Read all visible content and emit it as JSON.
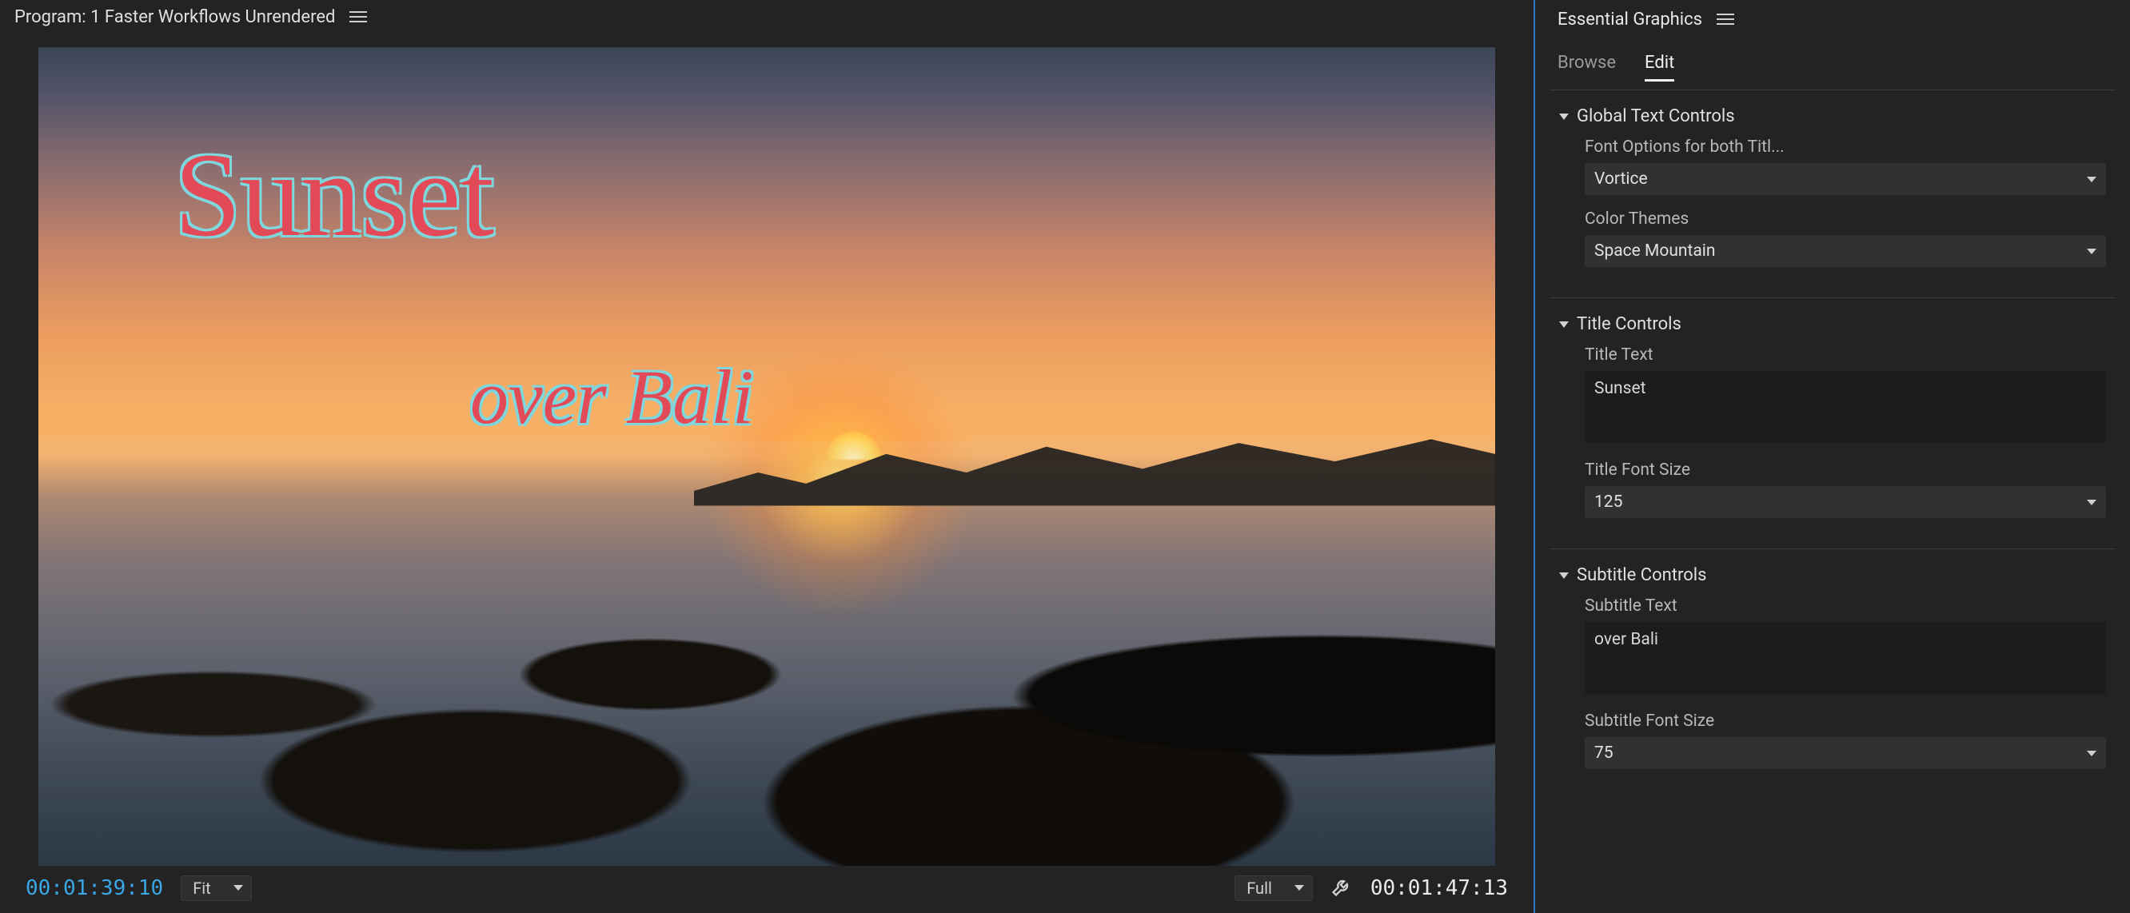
{
  "program": {
    "title": "Program: 1 Faster Workflows Unrendered",
    "timecode_in": "00:01:39:10",
    "timecode_out": "00:01:47:13",
    "zoom": "Fit",
    "resolution": "Full"
  },
  "overlay": {
    "title": "Sunset",
    "subtitle": "over Bali"
  },
  "eg": {
    "panel_title": "Essential Graphics",
    "tabs": {
      "browse": "Browse",
      "edit": "Edit"
    },
    "global": {
      "header": "Global Text Controls",
      "font_label": "Font Options for both Titl...",
      "font_value": "Vortice",
      "color_label": "Color Themes",
      "color_value": "Space Mountain"
    },
    "title_controls": {
      "header": "Title Controls",
      "text_label": "Title Text",
      "text_value": "Sunset",
      "size_label": "Title Font Size",
      "size_value": "125"
    },
    "subtitle_controls": {
      "header": "Subtitle Controls",
      "text_label": "Subtitle Text",
      "text_value": "over Bali",
      "size_label": "Subtitle Font Size",
      "size_value": "75"
    }
  }
}
